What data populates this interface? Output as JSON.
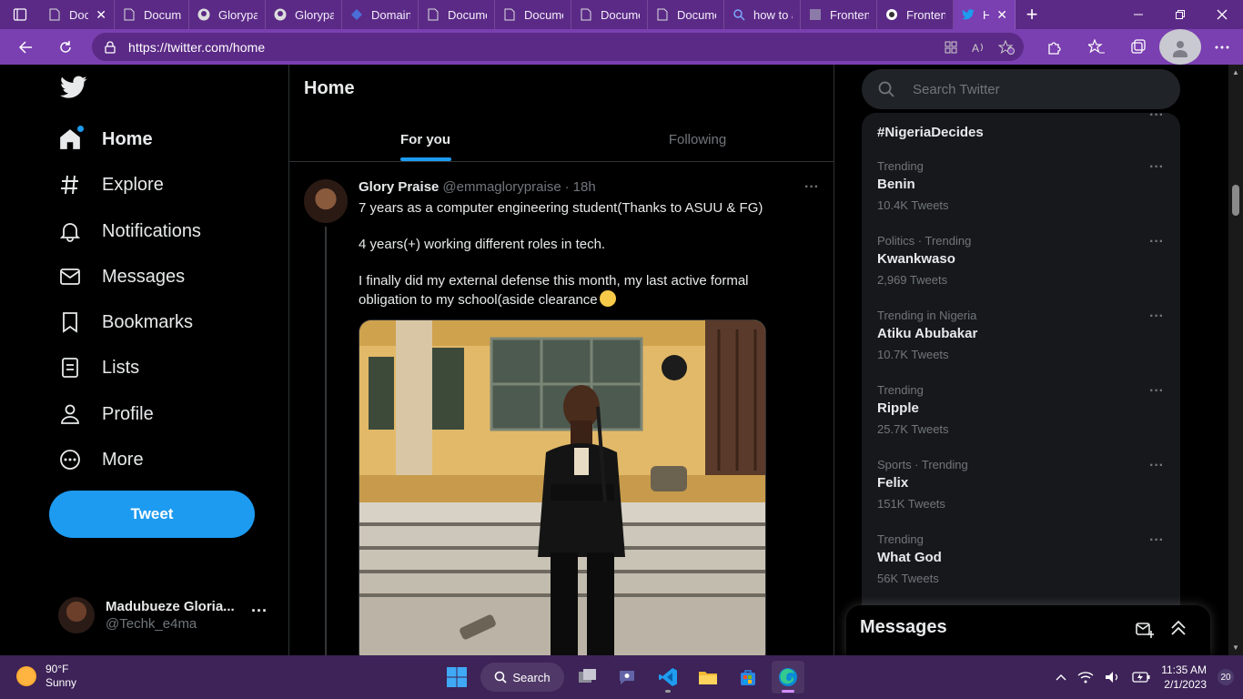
{
  "browser": {
    "tabs": [
      {
        "label": "Doc",
        "icon": "document-icon"
      },
      {
        "label": "Documen",
        "icon": "document-icon"
      },
      {
        "label": "Glorypau",
        "icon": "github-icon"
      },
      {
        "label": "Glorypau",
        "icon": "github-icon"
      },
      {
        "label": "Domain n",
        "icon": "diamond-icon"
      },
      {
        "label": "Documen",
        "icon": "document-icon"
      },
      {
        "label": "Documen",
        "icon": "document-icon"
      },
      {
        "label": "Documen",
        "icon": "document-icon"
      },
      {
        "label": "Documen",
        "icon": "document-icon"
      },
      {
        "label": "how to a",
        "icon": "search-icon"
      },
      {
        "label": "Frontend",
        "icon": "image-icon"
      },
      {
        "label": "Frontend",
        "icon": "circle-icon"
      },
      {
        "label": "Hom",
        "icon": "twitter-icon",
        "active": true
      }
    ],
    "url": "https://twitter.com/home",
    "accent": "#7a3fb0"
  },
  "nav": {
    "items": [
      {
        "label": "Home",
        "icon": "home-icon",
        "active": true
      },
      {
        "label": "Explore",
        "icon": "hashtag-icon"
      },
      {
        "label": "Notifications",
        "icon": "bell-icon"
      },
      {
        "label": "Messages",
        "icon": "envelope-icon"
      },
      {
        "label": "Bookmarks",
        "icon": "bookmark-icon"
      },
      {
        "label": "Lists",
        "icon": "list-icon"
      },
      {
        "label": "Profile",
        "icon": "person-icon"
      },
      {
        "label": "More",
        "icon": "more-circle-icon"
      }
    ],
    "tweet_button": "Tweet",
    "account": {
      "name": "Madubueze Gloria...",
      "handle": "@Techk_e4ma"
    }
  },
  "timeline": {
    "title": "Home",
    "tabs": [
      "For you",
      "Following"
    ],
    "tweet": {
      "name": "Glory Praise",
      "handle": "@emmaglorypraise",
      "sep": "·",
      "time": "18h",
      "paragraphs": [
        "7 years as a computer engineering student(Thanks to ASUU & FG)",
        "4 years(+) working different roles in tech.",
        "I finally did my external defense this month, my last active formal obligation to my school(aside clearance"
      ]
    }
  },
  "sidebar": {
    "search_placeholder": "Search Twitter",
    "trends": [
      {
        "context": "",
        "topic": "#NigeriaDecides",
        "count": ""
      },
      {
        "context": "Trending",
        "topic": "Benin",
        "count": "10.4K Tweets"
      },
      {
        "context": "Politics · Trending",
        "topic": "Kwankwaso",
        "count": "2,969 Tweets"
      },
      {
        "context": "Trending in Nigeria",
        "topic": "Atiku Abubakar",
        "count": "10.7K Tweets"
      },
      {
        "context": "Trending",
        "topic": "Ripple",
        "count": "25.7K Tweets"
      },
      {
        "context": "Sports · Trending",
        "topic": "Felix",
        "count": "151K Tweets"
      },
      {
        "context": "Trending",
        "topic": "What God",
        "count": "56K Tweets"
      }
    ],
    "messages_title": "Messages"
  },
  "taskbar": {
    "weather_temp": "90°F",
    "weather_desc": "Sunny",
    "search_label": "Search",
    "time": "11:35 AM",
    "date": "2/1/2023",
    "notification_count": "20"
  }
}
